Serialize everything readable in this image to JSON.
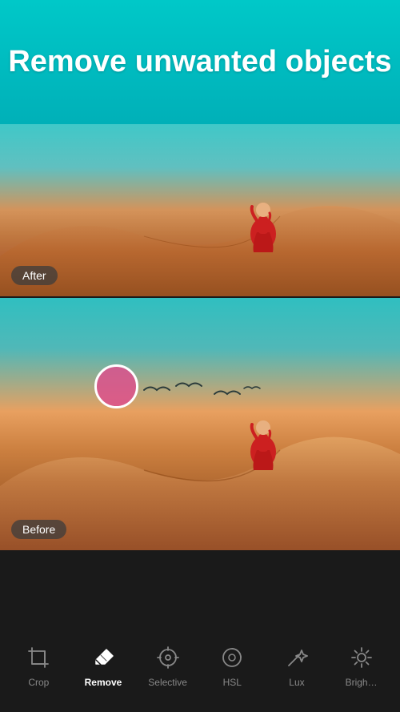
{
  "header": {
    "title": "Remove\nunwanted objects",
    "background_color": "#00c0c0"
  },
  "after_panel": {
    "badge": "After"
  },
  "before_panel": {
    "badge": "Before"
  },
  "toolbar": {
    "items": [
      {
        "id": "crop",
        "label": "Crop",
        "icon": "crop",
        "active": false
      },
      {
        "id": "remove",
        "label": "Remove",
        "icon": "eraser",
        "active": true
      },
      {
        "id": "selective",
        "label": "Selective",
        "icon": "selective",
        "active": false
      },
      {
        "id": "hsl",
        "label": "HSL",
        "icon": "hsl",
        "active": false
      },
      {
        "id": "lux",
        "label": "Lux",
        "icon": "lux",
        "active": false
      },
      {
        "id": "brightness",
        "label": "Brigh…",
        "icon": "brightness",
        "active": false
      }
    ]
  }
}
